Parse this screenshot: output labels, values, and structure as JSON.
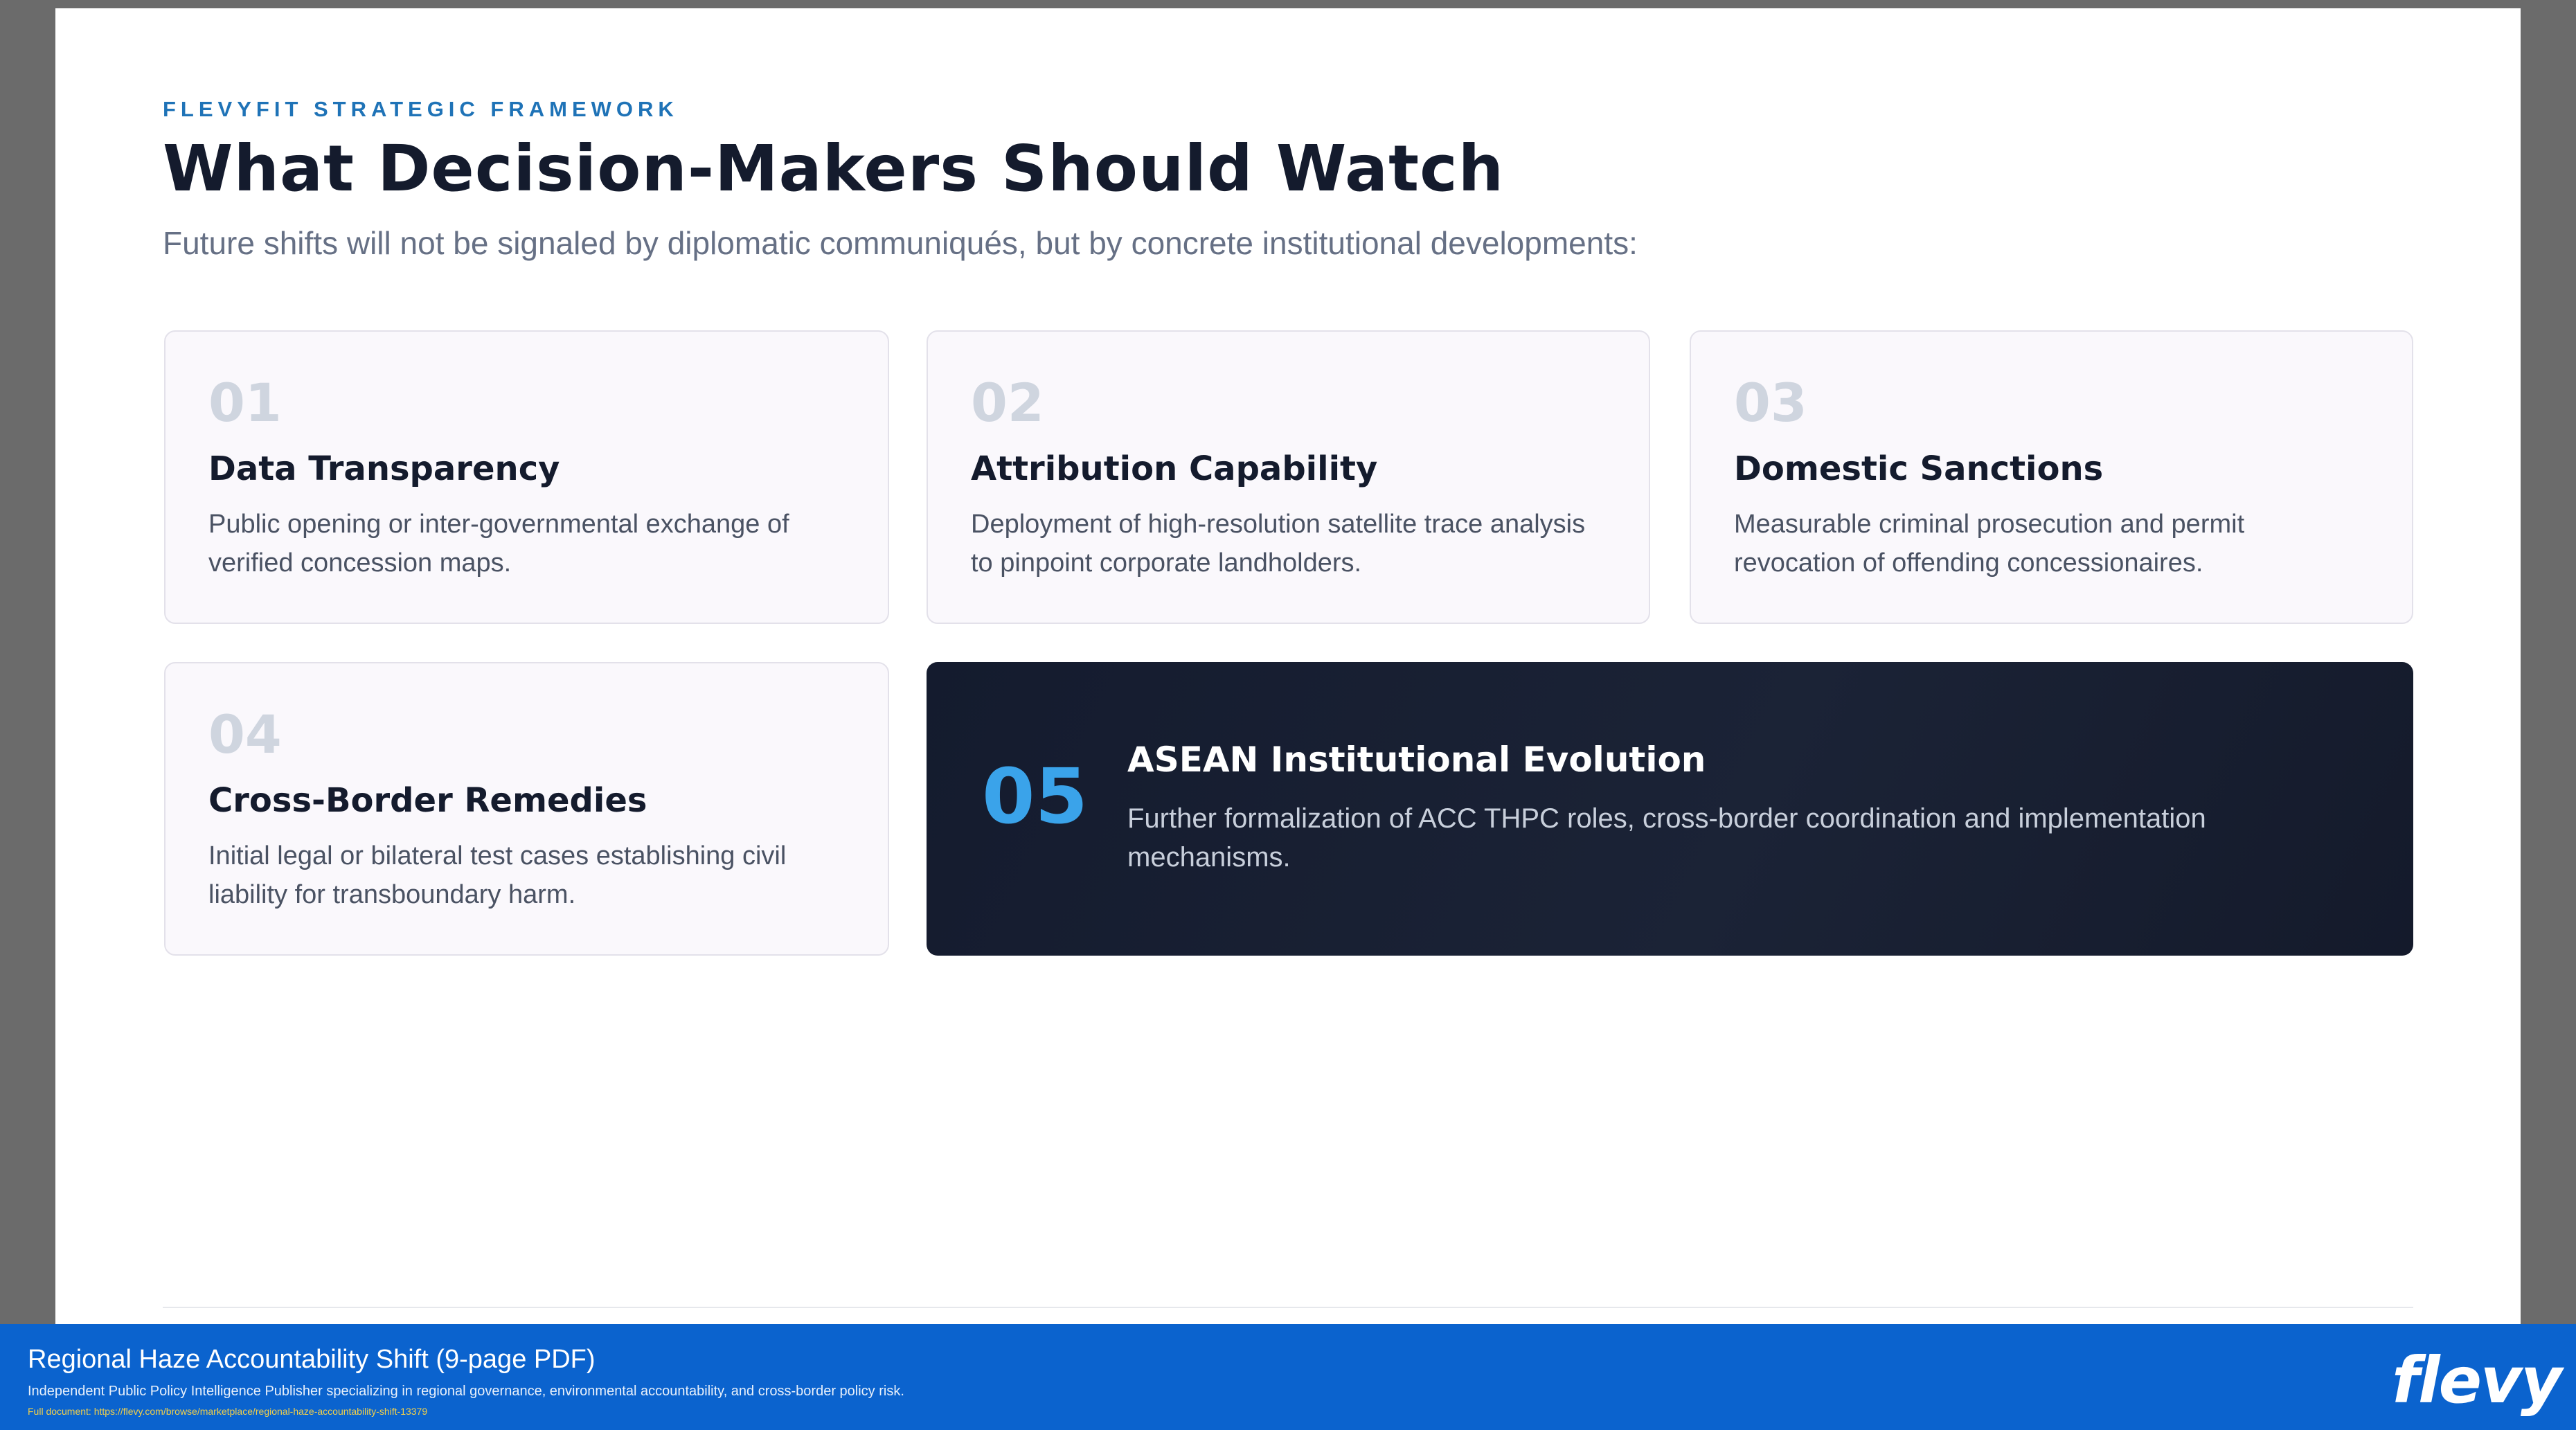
{
  "header": {
    "eyebrow": "FLEVYFIT STRATEGIC FRAMEWORK",
    "title": "What Decision-Makers Should Watch",
    "subtitle": "Future shifts will not be signaled by diplomatic communiqués, but by concrete institutional developments:"
  },
  "cards": [
    {
      "number": "01",
      "title": "Data Transparency",
      "description": "Public opening or inter-governmental exchange of verified concession maps."
    },
    {
      "number": "02",
      "title": "Attribution Capability",
      "description": "Deployment of high-resolution satellite trace analysis to pinpoint corporate landholders."
    },
    {
      "number": "03",
      "title": "Domestic Sanctions",
      "description": "Measurable criminal prosecution and permit revocation of offending concessionaires."
    },
    {
      "number": "04",
      "title": "Cross-Border Remedies",
      "description": "Initial legal or bilateral test cases establishing civil liability for transboundary harm."
    },
    {
      "number": "05",
      "title": "ASEAN Institutional Evolution",
      "description": "Further formalization of ACC THPC roles, cross-border coordination and implementation mechanisms."
    }
  ],
  "footer": {
    "doc_title": "Regional Haze Accountability Shift",
    "doc_pages": "(9-page PDF)",
    "publisher_desc": "Independent Public Policy Intelligence Publisher specializing in regional governance, environmental accountability, and cross-border policy risk.",
    "full_document": "Full document: https://flevy.com/browse/marketplace/regional-haze-accountability-shift-13379",
    "logo": "flevy"
  },
  "colors": {
    "accent": "#1f73b7",
    "dark_card": "#141b2e",
    "dark_card_number": "#3aa3ea",
    "footer_bar": "#0b63ce"
  }
}
